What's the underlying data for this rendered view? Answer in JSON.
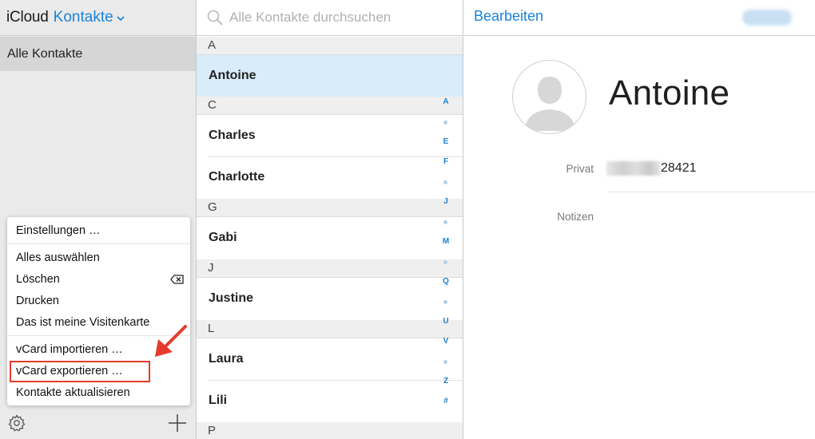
{
  "sidebar": {
    "brand": "iCloud",
    "app_name": "Kontakte",
    "group": "Alle Kontakte",
    "menu": {
      "settings": "Einstellungen …",
      "select_all": "Alles auswählen",
      "delete": "Löschen",
      "print": "Drucken",
      "my_card": "Das ist meine Visitenkarte",
      "import_vcard": "vCard importieren …",
      "export_vcard": "vCard exportieren …",
      "refresh": "Kontakte aktualisieren"
    }
  },
  "contact_list": {
    "search_placeholder": "Alle Kontakte durchsuchen",
    "sections": [
      {
        "letter": "A",
        "contacts": [
          "Antoine"
        ]
      },
      {
        "letter": "C",
        "contacts": [
          "Charles",
          "Charlotte"
        ]
      },
      {
        "letter": "G",
        "contacts": [
          "Gabi"
        ]
      },
      {
        "letter": "J",
        "contacts": [
          "Justine"
        ]
      },
      {
        "letter": "L",
        "contacts": [
          "Laura",
          "Lili"
        ]
      },
      {
        "letter": "P",
        "contacts": []
      }
    ],
    "selected": "Antoine",
    "index_letters": [
      "A",
      "E",
      "F",
      "J",
      "M",
      "Q",
      "U",
      "V",
      "Z",
      "#"
    ]
  },
  "detail": {
    "edit_label": "Bearbeiten",
    "name": "Antoine",
    "phone_label": "Privat",
    "phone_value": "28421",
    "notes_label": "Notizen"
  },
  "colors": {
    "accent": "#1a82d9",
    "selected_row": "#d8ecfa",
    "annotation": "#e43b2c"
  }
}
